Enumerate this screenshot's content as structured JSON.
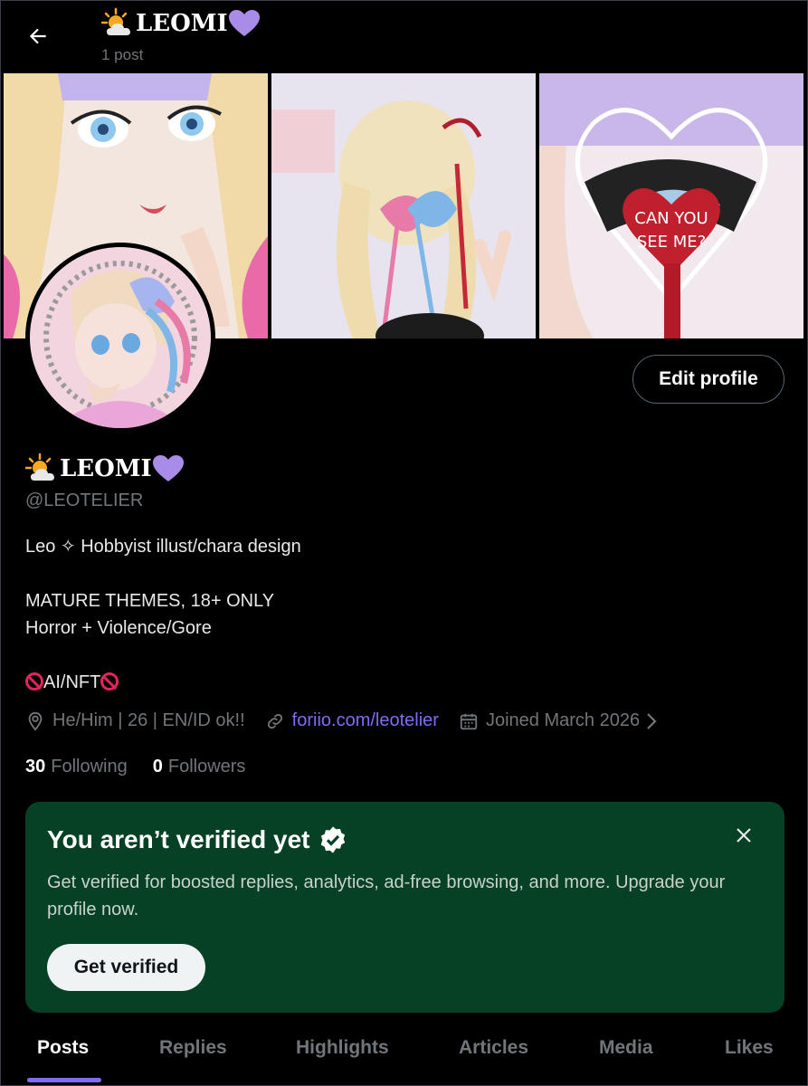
{
  "header": {
    "name": "LEOMI",
    "post_count": "1 post"
  },
  "profile": {
    "name": "LEOMI",
    "handle": "@LEOTELIER",
    "edit_label": "Edit profile",
    "bio_line1": "Leo ✧ Hobbyist illust/chara design",
    "bio_line2": "MATURE THEMES, 18+ ONLY",
    "bio_line3": "Horror + Violence/Gore",
    "bio_line4": "AI/NFT",
    "location": "He/Him | 26 | EN/ID ok!!",
    "website": "foriio.com/leotelier",
    "joined": "Joined March 2026",
    "following_count": "30",
    "following_label": "Following",
    "followers_count": "0",
    "followers_label": "Followers"
  },
  "banner": {
    "panel3_text_line1": "CAN YOU",
    "panel3_text_line2": "SEE ME?"
  },
  "verify": {
    "title": "You aren’t verified yet",
    "text": "Get verified for boosted replies, analytics, ad-free browsing, and more. Upgrade your profile now.",
    "button": "Get verified"
  },
  "tabs": [
    "Posts",
    "Replies",
    "Highlights",
    "Articles",
    "Media",
    "Likes"
  ],
  "colors": {
    "accent": "#7e6cf6",
    "verify_bg": "#064025",
    "heart": "#a98be8"
  },
  "icons": [
    "back-arrow-icon",
    "sun-cloud-icon",
    "purple-heart-icon",
    "location-icon",
    "link-icon",
    "calendar-icon",
    "chevron-right-icon",
    "verified-badge-icon",
    "close-icon",
    "no-entry-icon"
  ]
}
